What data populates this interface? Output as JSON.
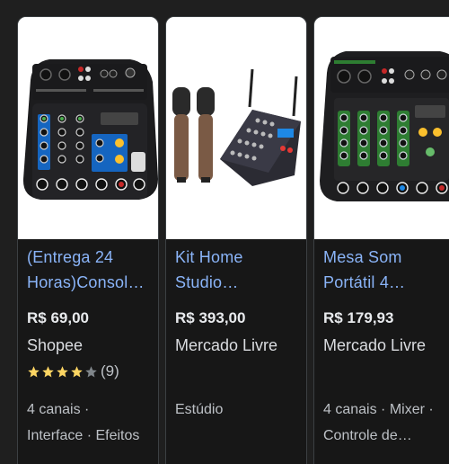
{
  "products": [
    {
      "title": "(Entrega 24\nHoras)Consol…",
      "price": "R$ 69,00",
      "store": "Shopee",
      "rating_value": 4,
      "rating_max": 5,
      "rating_count": "(9)",
      "description": "4 canais ·\nInterface · Efeitos",
      "image_icon": "audio-mixer-image"
    },
    {
      "title": "Kit Home\nStudio…",
      "price": "R$ 393,00",
      "store": "Mercado Livre",
      "description": "Estúdio",
      "image_icon": "microphones-and-mixer-image"
    },
    {
      "title": "Mesa Som\nPortátil 4…",
      "price": "R$ 179,93",
      "store": "Mercado Livre",
      "description": "4 canais · Mixer ·\nControle de…",
      "image_icon": "portable-mixer-image"
    }
  ],
  "colors": {
    "background": "#1f1f1f",
    "card": "#171717",
    "card_border": "#3c4043",
    "title_link": "#8ab4f8",
    "price": "#e8eaed",
    "star_filled": "#fdd663",
    "star_empty": "#80868b"
  }
}
